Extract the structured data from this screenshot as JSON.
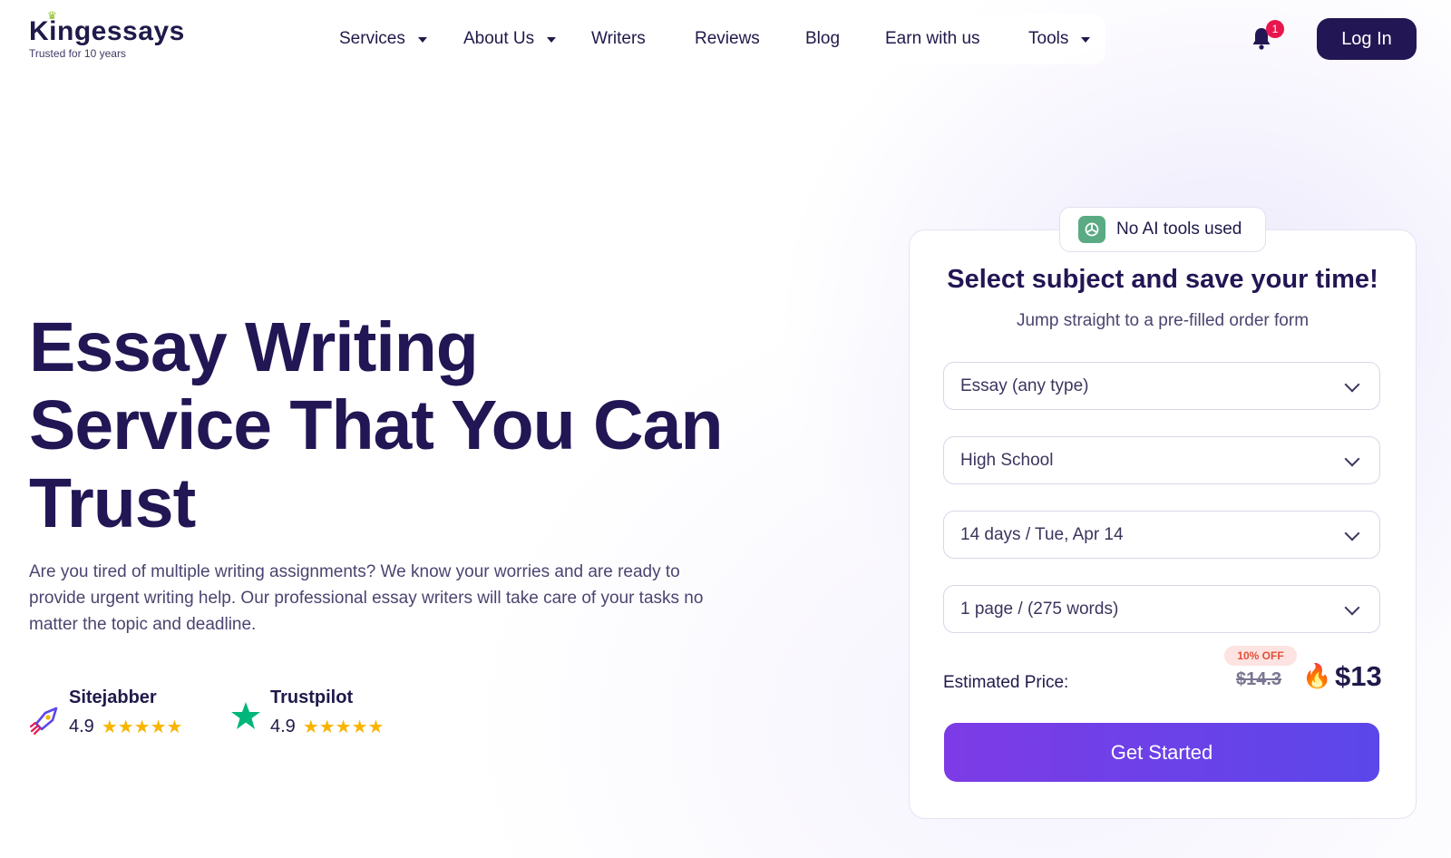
{
  "brand": {
    "name": "Kingessays",
    "tagline": "Trusted for 10 years",
    "accent_color": "#231654",
    "cta_gradient": [
      "#7d3be6",
      "#5b47ea"
    ]
  },
  "nav": {
    "items": [
      {
        "label": "Services",
        "dropdown": true
      },
      {
        "label": "About Us",
        "dropdown": true
      },
      {
        "label": "Writers",
        "dropdown": false
      },
      {
        "label": "Reviews",
        "dropdown": false
      },
      {
        "label": "Blog",
        "dropdown": false
      },
      {
        "label": "Earn with us",
        "dropdown": false
      },
      {
        "label": "Tools",
        "dropdown": true
      }
    ],
    "notifications_count": "1",
    "login_label": "Log In"
  },
  "hero": {
    "title_line1": "Essay Writing",
    "title_line2": "Service That You Can",
    "title_line3": "Trust",
    "description": "Are you tired of multiple writing assignments? We know your worries and are ready to provide urgent writing help. Our professional essay writers will take care of your tasks no matter the topic and deadline."
  },
  "ratings": [
    {
      "name": "Sitejabber",
      "score": "4.9",
      "stars": "★★★★★",
      "icon": "sitejabber-rocket-icon"
    },
    {
      "name": "Trustpilot",
      "score": "4.9",
      "stars": "★★★★★",
      "icon": "trustpilot-star-icon"
    }
  ],
  "order_form": {
    "badge": "No AI tools used",
    "title": "Select subject and save your time!",
    "subtitle": "Jump straight to a pre-filled order form",
    "selects": [
      {
        "value": "Essay (any type)"
      },
      {
        "value": "High School"
      },
      {
        "value": "14 days / Tue, Apr 14"
      },
      {
        "value": "1 page / (275 words)"
      }
    ],
    "price_label": "Estimated Price:",
    "discount_badge": "10% OFF",
    "old_price": "$14.3",
    "new_price": "$13",
    "cta_label": "Get Started"
  }
}
